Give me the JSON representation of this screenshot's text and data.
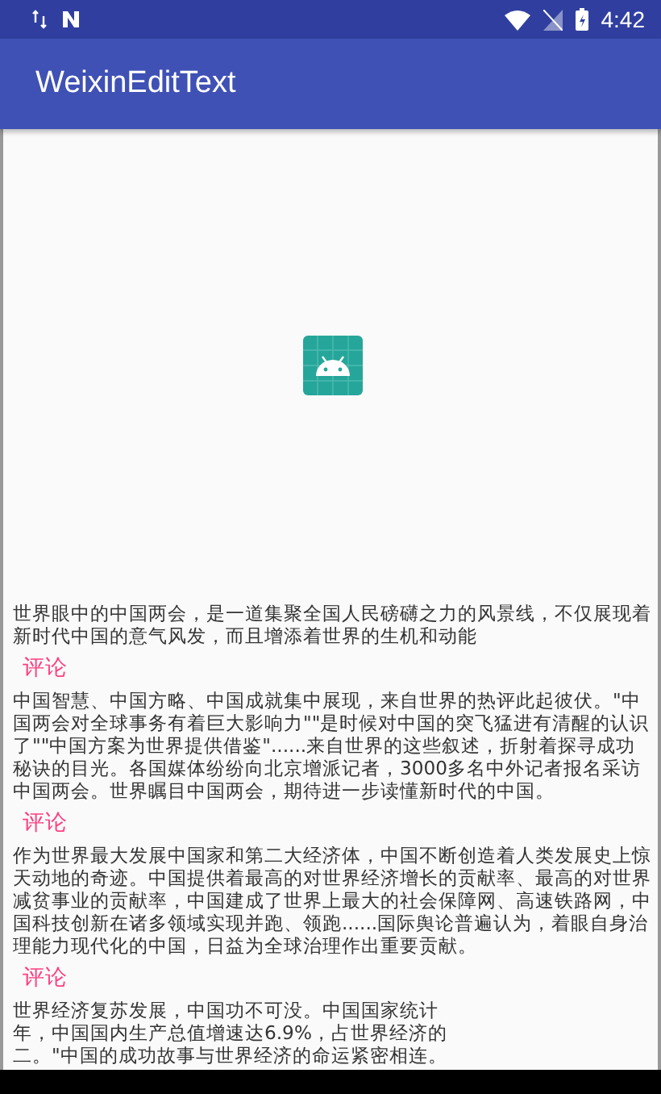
{
  "status_bar": {
    "time": "4:42"
  },
  "app_bar": {
    "title": "WeixinEditText"
  },
  "articles": [
    {
      "text": "世界眼中的中国两会，是一道集聚全国人民磅礴之力的风景线，不仅展现着新时代中国的意气风发，而且增添着世界的生机和动能",
      "comment": "评论"
    },
    {
      "text": "中国智慧、中国方略、中国成就集中展现，来自世界的热评此起彼伏。\"中国两会对全球事务有着巨大影响力\"\"是时候对中国的突飞猛进有清醒的认识了\"\"中国方案为世界提供借鉴\"......来自世界的这些叙述，折射着探寻成功秘诀的目光。各国媒体纷纷向北京增派记者，3000多名中外记者报名采访中国两会。世界瞩目中国两会，期待进一步读懂新时代的中国。",
      "comment": "评论"
    },
    {
      "text": "作为世界最大发展中国家和第二大经济体，中国不断创造着人类发展史上惊天动地的奇迹。中国提供着最高的对世界经济增长的贡献率、最高的对世界减贫事业的贡献率，中国建成了世界上最大的社会保障网、高速铁路网，中国科技创新在诸多领域实现并跑、领跑......国际舆论普遍认为，着眼自身治理能力现代化的中国，日益为全球治理作出重要贡献。",
      "comment": "评论"
    }
  ],
  "last_article": {
    "lines": [
      "世界经济复苏发展，中国功不可没。中国国家统计",
      "年，中国国内生产总值增速达6.9%，占世界经济的",
      "二。\"中国的成功故事与世界经济的命运紧密相连。"
    ]
  }
}
